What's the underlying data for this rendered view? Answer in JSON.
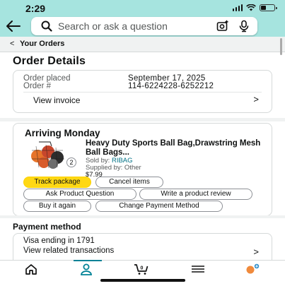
{
  "status": {
    "time": "2:29"
  },
  "search": {
    "placeholder": "Search or ask a question"
  },
  "breadcrumb": {
    "chevron": "<",
    "label": "Your Orders"
  },
  "page": {
    "title": "Order Details"
  },
  "order": {
    "placed_label": "Order placed",
    "placed_value": "September 17, 2025",
    "number_label": "Order #",
    "number_value": "114-6224228-6252212",
    "invoice_label": "View invoice",
    "invoice_chevron": ">"
  },
  "shipment": {
    "title": "Arriving Monday",
    "product_title": "Heavy Duty Sports Ball Bag,Drawstring Mesh Ball Bags...",
    "sold_by_label": "Sold by:",
    "sold_by_value": "RIBAG",
    "supplied_by": "Supplied by: Other",
    "price": "$7.99",
    "quantity": "2",
    "buttons": {
      "track": "Track package",
      "cancel": "Cancel items",
      "ask": "Ask Product Question",
      "review": "Write a product review",
      "buy_again": "Buy it again",
      "change_payment": "Change Payment Method"
    }
  },
  "payment": {
    "title": "Payment method",
    "card": "Visa  ending in 1791",
    "transactions_label": "View related transactions",
    "chevron": ">"
  },
  "tabs": [
    {
      "icon": "home-icon"
    },
    {
      "icon": "account-icon",
      "active": true
    },
    {
      "icon": "cart-icon"
    },
    {
      "icon": "menu-icon"
    },
    {
      "icon": "rufus-assistant-icon"
    }
  ],
  "colors": {
    "header_bg": "#a6e4df",
    "primary_button": "#ffd814",
    "link": "#007185",
    "active_tab": "#008296"
  }
}
